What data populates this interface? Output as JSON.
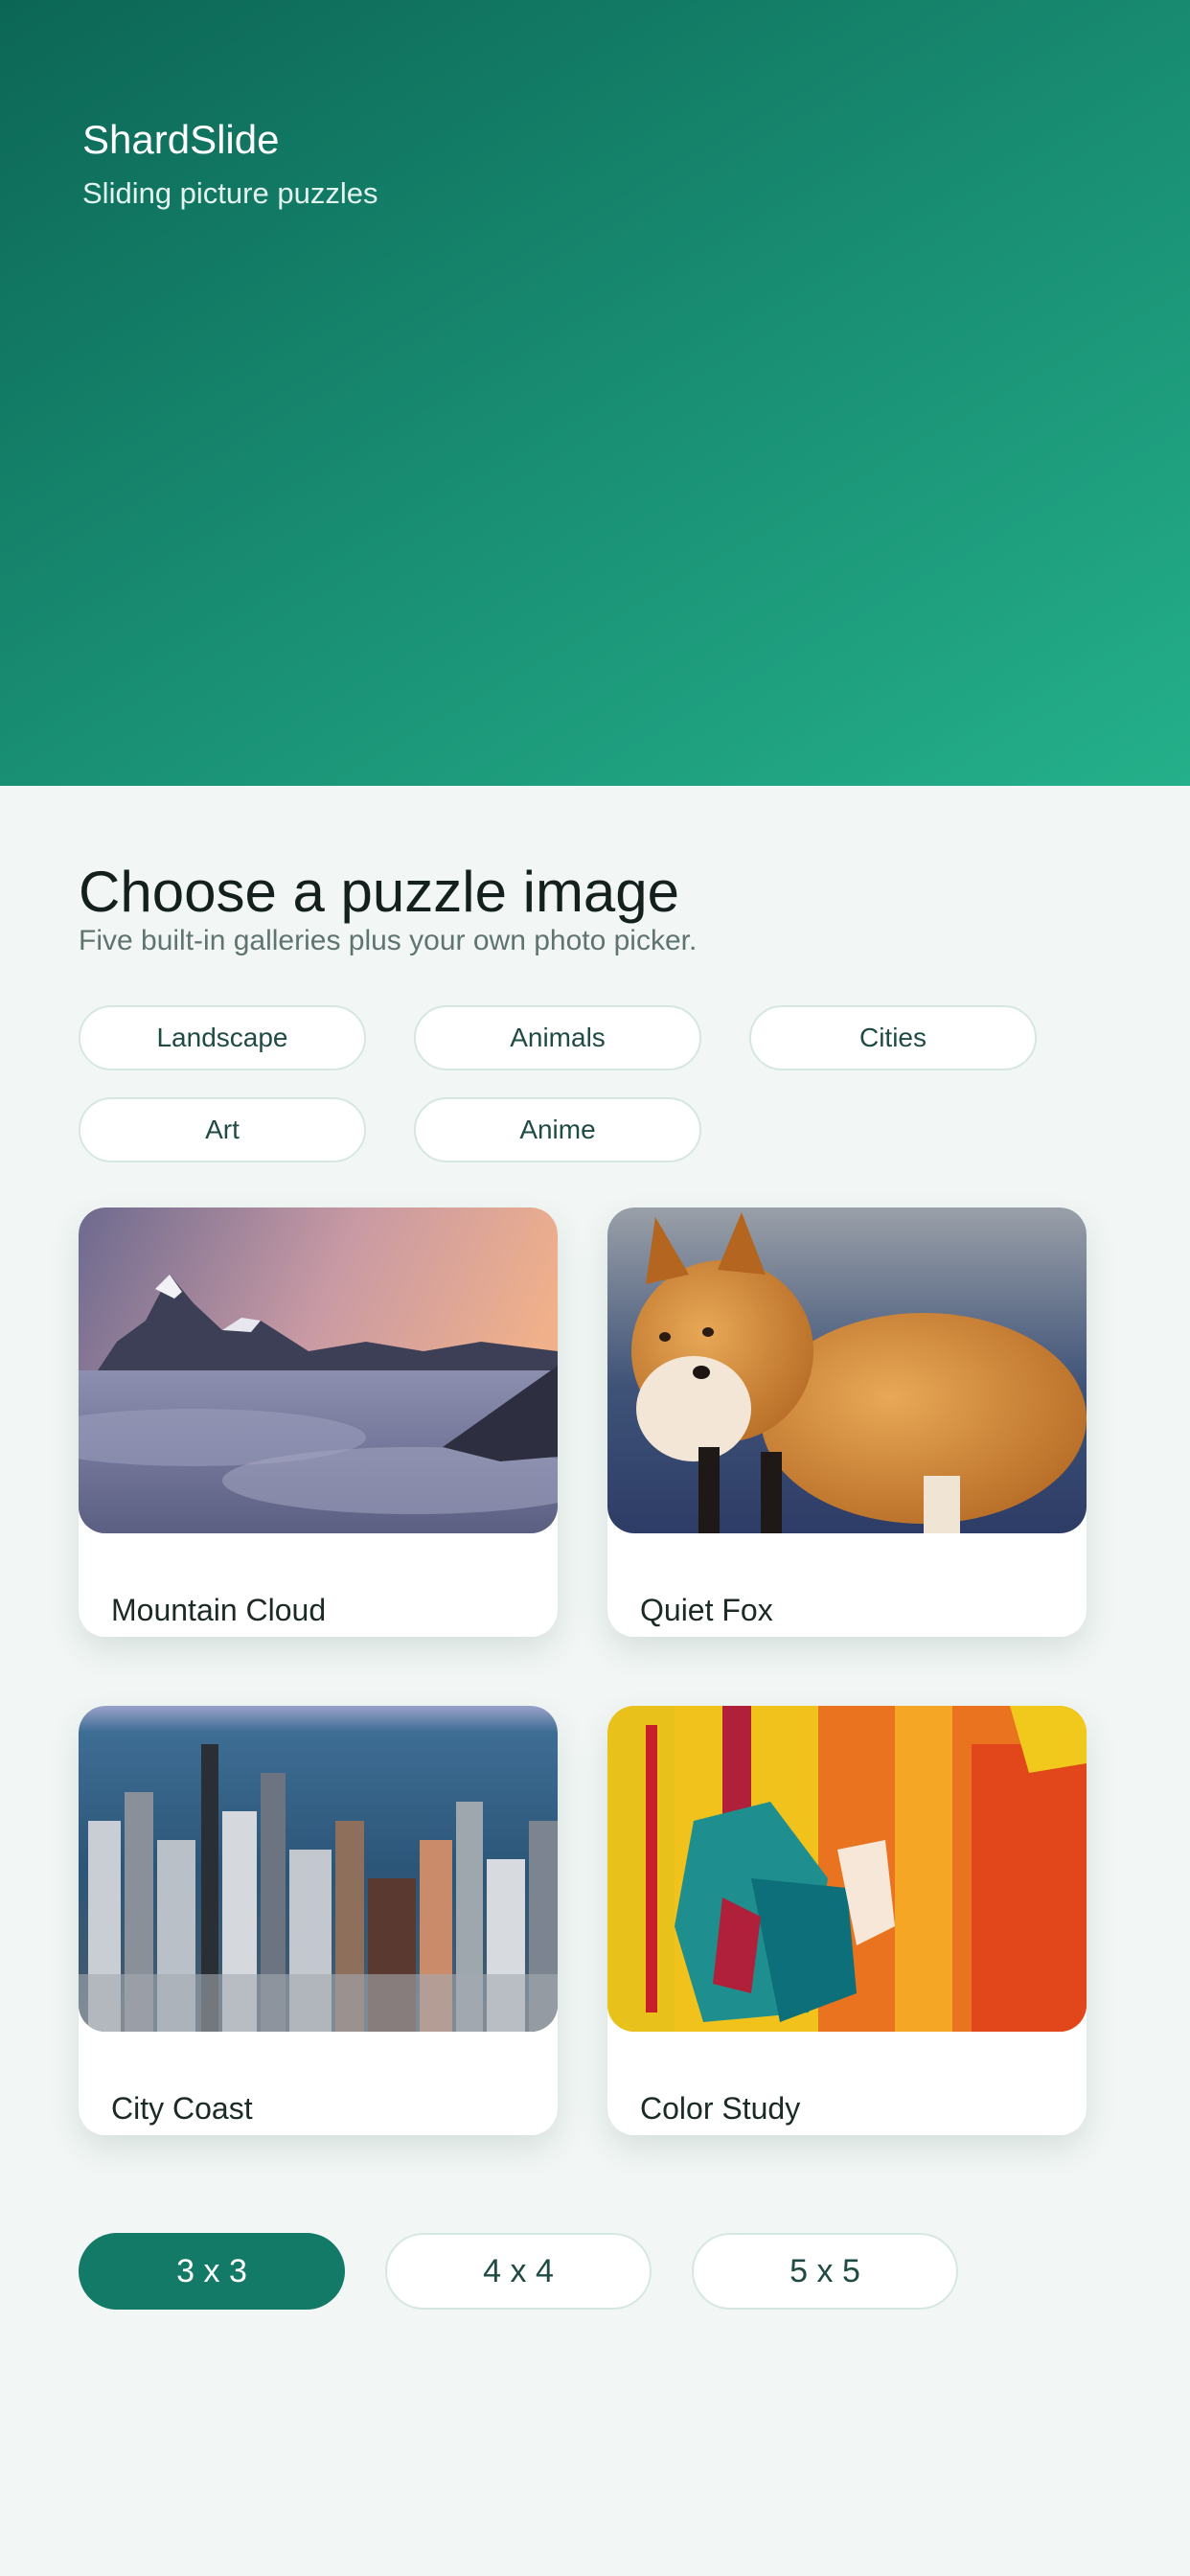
{
  "app": {
    "title": "ShardSlide",
    "subtitle": "Sliding picture puzzles"
  },
  "section": {
    "title": "Choose a puzzle image",
    "subtitle": "Five built-in galleries plus your own photo picker."
  },
  "categories": [
    {
      "label": "Landscape"
    },
    {
      "label": "Animals"
    },
    {
      "label": "Cities"
    },
    {
      "label": "Art"
    },
    {
      "label": "Anime"
    }
  ],
  "images": [
    {
      "title": "Mountain Cloud",
      "image": "mountain-cloud-photo"
    },
    {
      "title": "Quiet Fox",
      "image": "fox-photo"
    },
    {
      "title": "City Coast",
      "image": "city-skyline-photo"
    },
    {
      "title": "Color Study",
      "image": "abstract-painting-photo"
    }
  ],
  "grid_sizes": [
    {
      "label": "3 x 3",
      "selected": true
    },
    {
      "label": "4 x 4",
      "selected": false
    },
    {
      "label": "5 x 5",
      "selected": false
    }
  ],
  "colors": {
    "hero_start": "#0c6656",
    "hero_end": "#24b08a",
    "accent": "#127a66",
    "background": "#f2f7f5"
  }
}
